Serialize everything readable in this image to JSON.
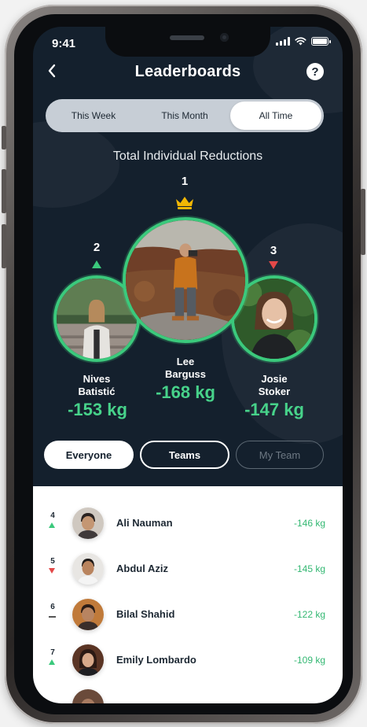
{
  "status_bar": {
    "time": "9:41"
  },
  "header": {
    "title": "Leaderboards",
    "help_label": "?"
  },
  "period_tabs": [
    {
      "label": "This Week",
      "active": false
    },
    {
      "label": "This Month",
      "active": false
    },
    {
      "label": "All Time",
      "active": true
    }
  ],
  "section_title": "Total Individual Reductions",
  "podium": {
    "first": {
      "rank": "1",
      "first_name": "Lee",
      "last_name": "Barguss",
      "value": "-168 kg",
      "badge": "crown-icon"
    },
    "second": {
      "rank": "2",
      "first_name": "Nives",
      "last_name": "Batistić",
      "value": "-153 kg",
      "trend": "up"
    },
    "third": {
      "rank": "3",
      "first_name": "Josie",
      "last_name": "Stoker",
      "value": "-147 kg",
      "trend": "down"
    }
  },
  "filters": [
    {
      "label": "Everyone",
      "state": "selected"
    },
    {
      "label": "Teams",
      "state": "outline"
    },
    {
      "label": "My Team",
      "state": "disabled"
    }
  ],
  "list": [
    {
      "rank": "4",
      "trend": "up",
      "name": "Ali Nauman",
      "value": "-146 kg"
    },
    {
      "rank": "5",
      "trend": "down",
      "name": "Abdul Aziz",
      "value": "-145 kg"
    },
    {
      "rank": "6",
      "trend": "same",
      "name": "Bilal Shahid",
      "value": "-122 kg"
    },
    {
      "rank": "7",
      "trend": "up",
      "name": "Emily Lombardo",
      "value": "-109 kg"
    }
  ],
  "colors": {
    "accent_green": "#3bc97c",
    "down_red": "#e34848",
    "background": "#14202d"
  }
}
